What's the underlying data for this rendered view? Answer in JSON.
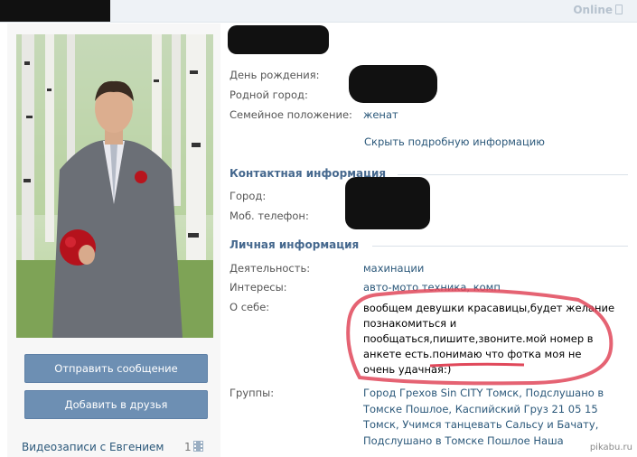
{
  "status": {
    "online": "Online"
  },
  "profile_photo_alt": "profile-photo",
  "actions": {
    "send_message": "Отправить сообщение",
    "add_friend": "Добавить в друзья"
  },
  "sidebar": {
    "videos_label": "Видеозаписи с Евгением",
    "videos_count": "1"
  },
  "info": {
    "birthday_label": "День рождения:",
    "hometown_label": "Родной город:",
    "marital_label": "Семейное положение:",
    "marital_value": "женат",
    "hide_details": "Скрыть подробную информацию"
  },
  "contact": {
    "title": "Контактная информация",
    "city_label": "Город:",
    "phone_label": "Моб. телефон:"
  },
  "personal": {
    "title": "Личная информация",
    "activity_label": "Деятельность:",
    "activity_value": "махинации",
    "interests_label": "Интересы:",
    "interests_value": "авто-мото техника, комп",
    "about_label": "О себе:",
    "about_value": "вообщем девушки красавицы,будет желание познакомиться и пообщаться,пишите,звоните.мой номер в анкете есть.понимаю что фотка моя не очень удачная:)",
    "groups_label": "Группы:",
    "groups_value": "Город Грехов Sin CITY Томск, Подслушано в Томске Пошлое, Каспийский Груз 21 05 15 Томск, Учимся танцевать Сальсу и Бачату, Подслушано в Томске Пошлое Наша"
  },
  "watermark": "pikabu.ru",
  "colors": {
    "link": "#2b587a",
    "section": "#45688e",
    "button": "#6d8fb3",
    "highlight": "#e0485a"
  }
}
